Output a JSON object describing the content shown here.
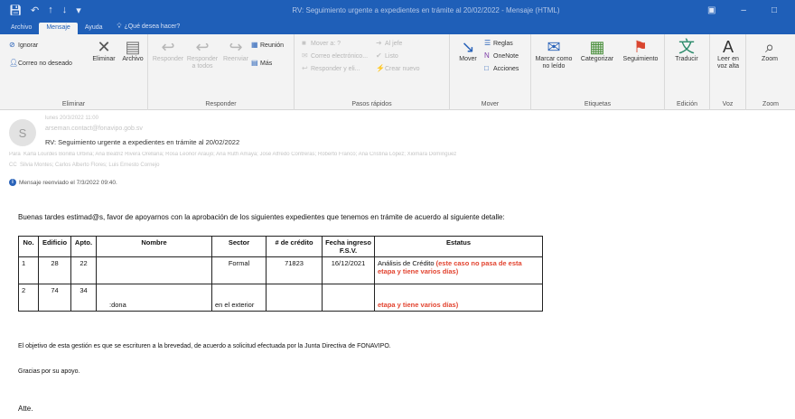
{
  "titlebar": {
    "save_icon": "save-icon",
    "undo_icon": "undo-icon",
    "title": "RV: Seguimiento urgente a expedientes en trámite al 20/02/2022 - Mensaje (HTML)"
  },
  "tabs": [
    {
      "label": "Archivo"
    },
    {
      "label": "Mensaje"
    },
    {
      "label": "Ayuda"
    },
    {
      "label": "¿Qué desea hacer?"
    }
  ],
  "ribbon": {
    "eliminar": {
      "label": "Eliminar",
      "ignorar": "Ignorar",
      "correo_no_deseado": "Correo no deseado",
      "eliminar_btn": "Eliminar",
      "archivo": "Archivo"
    },
    "responder": {
      "label": "Responder",
      "responder": "Responder",
      "responder_todos": "Responder a todos",
      "reenviar": "Reenviar",
      "reunion": "Reunión",
      "mas": "Más"
    },
    "pasos": {
      "label": "Pasos rápidos",
      "mover_a": "Mover a: ?",
      "al_jefe": "Al jefe",
      "correo_equipo": "Correo electrónico...",
      "listo": "Listo",
      "responder_eliminar": "Responder y eli...",
      "crear_nuevo": "Crear nuevo"
    },
    "mover": {
      "label": "Mover",
      "mover": "Mover",
      "reglas": "Reglas",
      "onenote": "OneNote",
      "acciones": "Acciones"
    },
    "etiquetas": {
      "label": "Etiquetas",
      "marcar": "Marcar como no leído",
      "categorizar": "Categorizar",
      "seguimiento": "Seguimiento"
    },
    "edicion": {
      "label": "Edición",
      "traducir": "Traducir"
    },
    "voz": {
      "label": "Voz",
      "leer": "Leer en voz alta"
    },
    "zoom": {
      "label": "Zoom",
      "zoom": "Zoom"
    }
  },
  "message": {
    "avatar_letter": "S",
    "date": "lunes 20/3/2022 11:00",
    "from": "arseman.contact@fonavipo.gob.sv",
    "subject": "RV: Seguimiento urgente a expedientes en trámite al 20/02/2022",
    "to_label": "Para",
    "to": "Karla Lourdes Bonilla Urbina; Ana Beatriz Rivera Orellana; Rosa Leonor Araujo; Ana Ruth Amaya; José Alfredo Contreras; Roberto Franco; Ana Cristina López; Xiomara Domínguez",
    "cc_label": "CC",
    "cc": "Silvia Montes; Carlos Alberto Flores; Luis Ernesto Cornejo",
    "forwarded": "Mensaje reenviado el 7/3/2022 09:40."
  },
  "body": {
    "greeting": "Buenas tardes estimad@s, favor de apoyarnos con la aprobación de los siguientes expedientes que tenemos en trámite de acuerdo al siguiente detalle:",
    "table": {
      "headers": [
        "No.",
        "Edificio",
        "Apto.",
        "Nombre",
        "Sector",
        "# de crédito",
        "Fecha ingreso F.S.V.",
        "Estatus"
      ],
      "rows": [
        {
          "no": "1",
          "edificio": "28",
          "apto": "22",
          "nombre": "",
          "sector": "Formal",
          "credito": "71823",
          "fecha": "16/12/2021",
          "estatus": "Análisis de Crédito",
          "estatus_note": "(este caso no pasa de esta etapa y tiene varios días)"
        },
        {
          "no": "2",
          "edificio": "74",
          "apto": "34",
          "nombre": ":dona",
          "sector": "en el exterior",
          "credito": "",
          "fecha": "",
          "estatus": "",
          "estatus_note": "etapa y tiene varios días)"
        }
      ]
    },
    "paragraph": "El objetivo de esta gestión es que se escrituren a la brevedad, de acuerdo a solicitud efectuada por la Junta Directiva de FONAVIPO.",
    "thanks": "Gracias por su apoyo.",
    "closing": "Atte."
  }
}
